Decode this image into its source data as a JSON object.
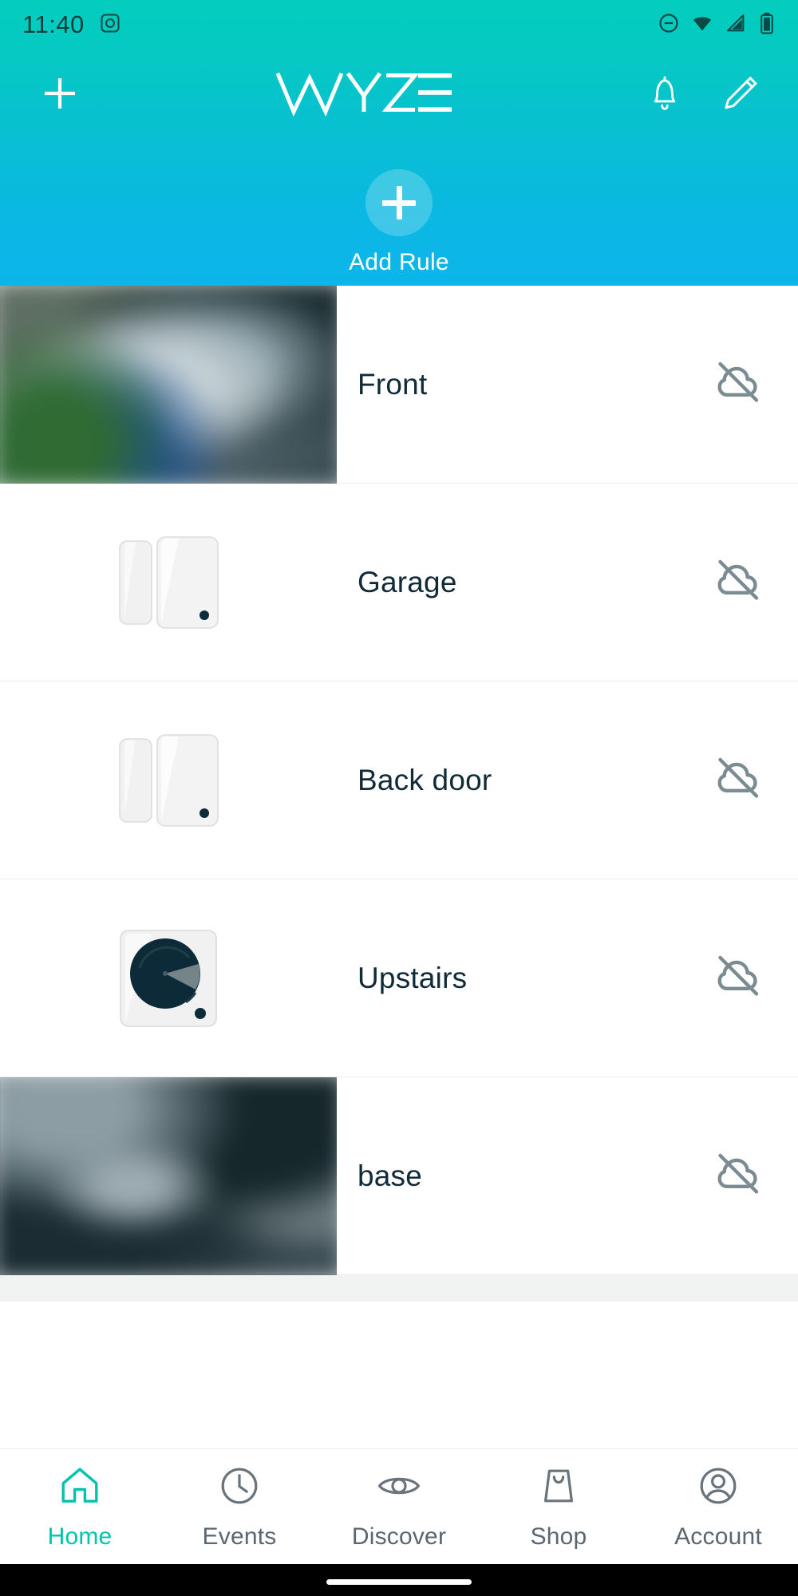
{
  "status_bar": {
    "time": "11:40",
    "left_icons": [
      "camera-icon"
    ],
    "right_icons": [
      "do-not-disturb-icon",
      "wifi-icon",
      "cellular-signal-icon",
      "battery-icon"
    ],
    "icon_color": "#0A4A45"
  },
  "app_bar": {
    "add_button": "add-icon",
    "logo_text": "WYZE",
    "notifications_button": "bell-icon",
    "edit_button": "pencil-icon"
  },
  "add_rule": {
    "label": "Add Rule",
    "icon": "plus-icon"
  },
  "theme": {
    "gradient_top": "#04CDBE",
    "gradient_bottom": "#0CB5EA",
    "accent": "#00C3AE",
    "text_dark": "#102A38",
    "text_muted": "#5B6670",
    "status_icon": "#7A8B91",
    "list_bg": "#F1F2F2"
  },
  "devices": [
    {
      "name": "Front",
      "thumb_type": "camera",
      "thumb_variant": "front",
      "status_icon": "cloud-off-icon"
    },
    {
      "name": "Garage",
      "thumb_type": "contact-sensor",
      "status_icon": "cloud-off-icon"
    },
    {
      "name": "Back door",
      "thumb_type": "contact-sensor",
      "status_icon": "cloud-off-icon"
    },
    {
      "name": "Upstairs",
      "thumb_type": "motion-sensor",
      "status_icon": "cloud-off-icon"
    },
    {
      "name": "base",
      "thumb_type": "camera",
      "thumb_variant": "base",
      "status_icon": "cloud-off-icon"
    }
  ],
  "bottom_nav": {
    "items": [
      {
        "label": "Home",
        "icon": "home-icon",
        "active": true
      },
      {
        "label": "Events",
        "icon": "clock-icon",
        "active": false
      },
      {
        "label": "Discover",
        "icon": "eye-icon",
        "active": false
      },
      {
        "label": "Shop",
        "icon": "bag-icon",
        "active": false
      },
      {
        "label": "Account",
        "icon": "person-icon",
        "active": false
      }
    ]
  }
}
